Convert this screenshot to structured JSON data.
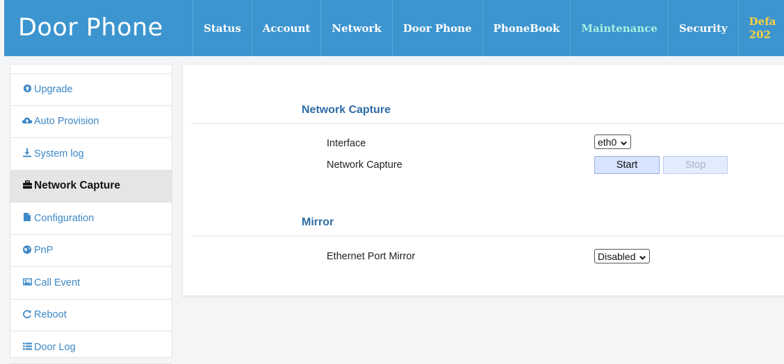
{
  "header": {
    "brand": "Door Phone",
    "nav": [
      {
        "label": "Status"
      },
      {
        "label": "Account"
      },
      {
        "label": "Network"
      },
      {
        "label": "Door Phone"
      },
      {
        "label": "PhoneBook"
      },
      {
        "label": "Maintenance",
        "active": true
      },
      {
        "label": "Security"
      }
    ],
    "nav_last": {
      "line1": "Defa",
      "line2": "202"
    },
    "colors": {
      "bar": "#3d95cf",
      "active": "#a6f0e2",
      "highlight": "#ffd23c"
    }
  },
  "sidebar": {
    "items": [
      {
        "label": "Upgrade",
        "icon": "arrow-circle-up-icon"
      },
      {
        "label": "Auto Provision",
        "icon": "cloud-upload-icon"
      },
      {
        "label": "System log",
        "icon": "download-icon"
      },
      {
        "label": "Network Capture",
        "icon": "briefcase-icon",
        "active": true
      },
      {
        "label": "Configuration",
        "icon": "file-icon"
      },
      {
        "label": "PnP",
        "icon": "globe-icon"
      },
      {
        "label": "Call Event",
        "icon": "image-icon"
      },
      {
        "label": "Reboot",
        "icon": "refresh-icon"
      },
      {
        "label": "Door Log",
        "icon": "list-icon"
      }
    ]
  },
  "capture": {
    "title": "Network Capture",
    "interface_label": "Interface",
    "interface_value": "eth0",
    "capture_label": "Network Capture",
    "start_label": "Start",
    "stop_label": "Stop"
  },
  "mirror": {
    "title": "Mirror",
    "port_label": "Ethernet Port Mirror",
    "port_value": "Disabled"
  }
}
